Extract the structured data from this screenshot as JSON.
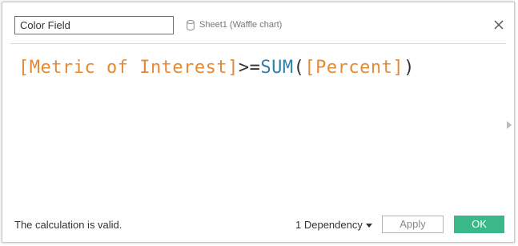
{
  "dialog": {
    "calc_name": "Color Field",
    "datasource_icon": "cylinder-database-icon",
    "datasource_label": "Sheet1 (Waffle chart)",
    "close_icon": "close-icon"
  },
  "formula": {
    "tokens": [
      {
        "type": "field",
        "text": "[Metric of Interest]"
      },
      {
        "type": "op",
        "text": ">="
      },
      {
        "type": "func",
        "text": "SUM"
      },
      {
        "type": "paren",
        "text": "("
      },
      {
        "type": "field",
        "text": "[Percent]"
      },
      {
        "type": "paren",
        "text": ")"
      }
    ]
  },
  "footer": {
    "status": "The calculation is valid.",
    "dependency": "1 Dependency",
    "apply_label": "Apply",
    "ok_label": "OK"
  },
  "colors": {
    "field": "#e58a34",
    "function": "#2f7fa7",
    "operator": "#333333",
    "ok_button": "#3ab88a"
  }
}
